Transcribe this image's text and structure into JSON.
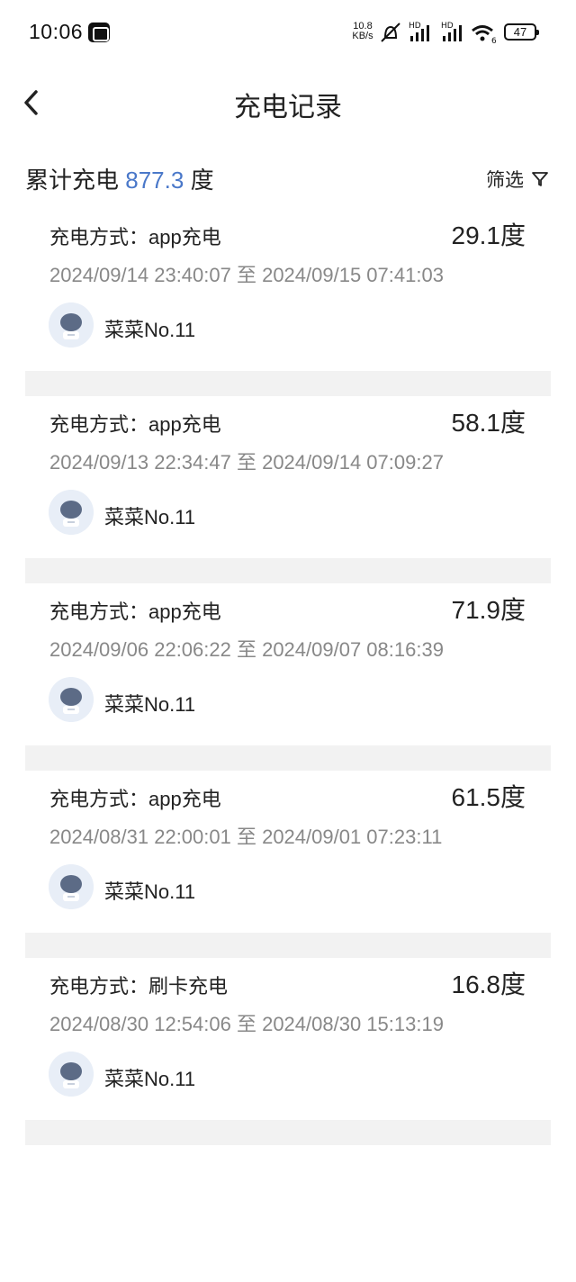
{
  "status_bar": {
    "time": "10:06",
    "net_speed_value": "10.8",
    "net_speed_unit": "KB/s",
    "signal_label_1": "HD",
    "signal_label_2": "HD",
    "wifi_label": "6",
    "battery": "47"
  },
  "nav": {
    "title": "充电记录"
  },
  "summary": {
    "prefix": "累计充电",
    "value": "877.3",
    "unit": "度",
    "filter_label": "筛选"
  },
  "records": [
    {
      "method": "充电方式：app充电",
      "amount": "29.1度",
      "timespan": "2024/09/14 23:40:07 至 2024/09/15 07:41:03",
      "user": "菜菜No.11"
    },
    {
      "method": "充电方式：app充电",
      "amount": "58.1度",
      "timespan": "2024/09/13 22:34:47 至 2024/09/14 07:09:27",
      "user": "菜菜No.11"
    },
    {
      "method": "充电方式：app充电",
      "amount": "71.9度",
      "timespan": "2024/09/06 22:06:22 至 2024/09/07 08:16:39",
      "user": "菜菜No.11"
    },
    {
      "method": "充电方式：app充电",
      "amount": "61.5度",
      "timespan": "2024/08/31 22:00:01 至 2024/09/01 07:23:11",
      "user": "菜菜No.11"
    },
    {
      "method": "充电方式：刷卡充电",
      "amount": "16.8度",
      "timespan": "2024/08/30 12:54:06 至 2024/08/30 15:13:19",
      "user": "菜菜No.11"
    }
  ],
  "colors": {
    "accent": "#4a78c9",
    "separator": "#f2f2f2",
    "secondary_text": "#888888"
  }
}
